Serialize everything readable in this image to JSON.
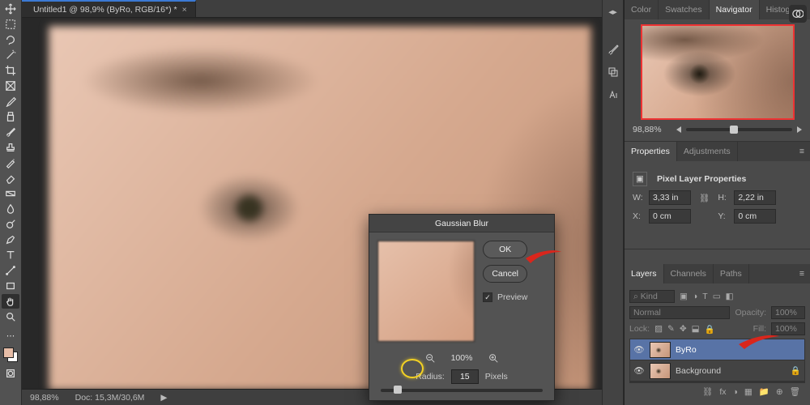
{
  "doc": {
    "tab_title": "Untitled1 @ 98,9% (ByRo, RGB/16*) *",
    "close": "×"
  },
  "status": {
    "zoom": "98,88%",
    "docinfo": "Doc: 15,3M/30,6M",
    "caret": "▶"
  },
  "navigator": {
    "tabs": [
      "Color",
      "Swatches",
      "Navigator",
      "Histogram"
    ],
    "active": "Navigator",
    "zoom": "98,88%",
    "knob_pct": 45
  },
  "properties": {
    "tabs": [
      "Properties",
      "Adjustments"
    ],
    "active": "Properties",
    "heading": "Pixel Layer Properties",
    "W_label": "W:",
    "W": "3,33 in",
    "link": "⛓",
    "H_label": "H:",
    "H": "2,22 in",
    "X_label": "X:",
    "X": "0 cm",
    "Y_label": "Y:",
    "Y": "0 cm"
  },
  "layers": {
    "tabs": [
      "Layers",
      "Channels",
      "Paths"
    ],
    "active": "Layers",
    "kind_label": "⌕ Kind",
    "blend": "Normal",
    "opacity_label": "Opacity:",
    "opacity": "100%",
    "lock_label": "Lock:",
    "fill_label": "Fill:",
    "fill": "100%",
    "rows": [
      {
        "name": "ByRo",
        "active": true,
        "locked": false
      },
      {
        "name": "Background",
        "active": false,
        "locked": true
      }
    ],
    "footer_icons": [
      "⛓",
      "fx",
      "◑",
      "▦",
      "📁",
      "⊕",
      "🗑"
    ]
  },
  "dialog": {
    "title": "Gaussian Blur",
    "ok": "OK",
    "cancel": "Cancel",
    "preview_label": "Preview",
    "preview_checked": true,
    "zoom": "100%",
    "radius_label": "Radius:",
    "radius": "15",
    "unit": "Pixels"
  },
  "tools": [
    "move",
    "marquee",
    "lasso",
    "wand",
    "crop",
    "frame",
    "eyedropper",
    "patch",
    "brush",
    "stamp",
    "history",
    "eraser",
    "gradient",
    "blur",
    "dodge",
    "pen",
    "type",
    "path",
    "rect",
    "hand",
    "zoom"
  ],
  "strip_icons": [
    "brush-panel",
    "clone-panel",
    "char-panel"
  ]
}
